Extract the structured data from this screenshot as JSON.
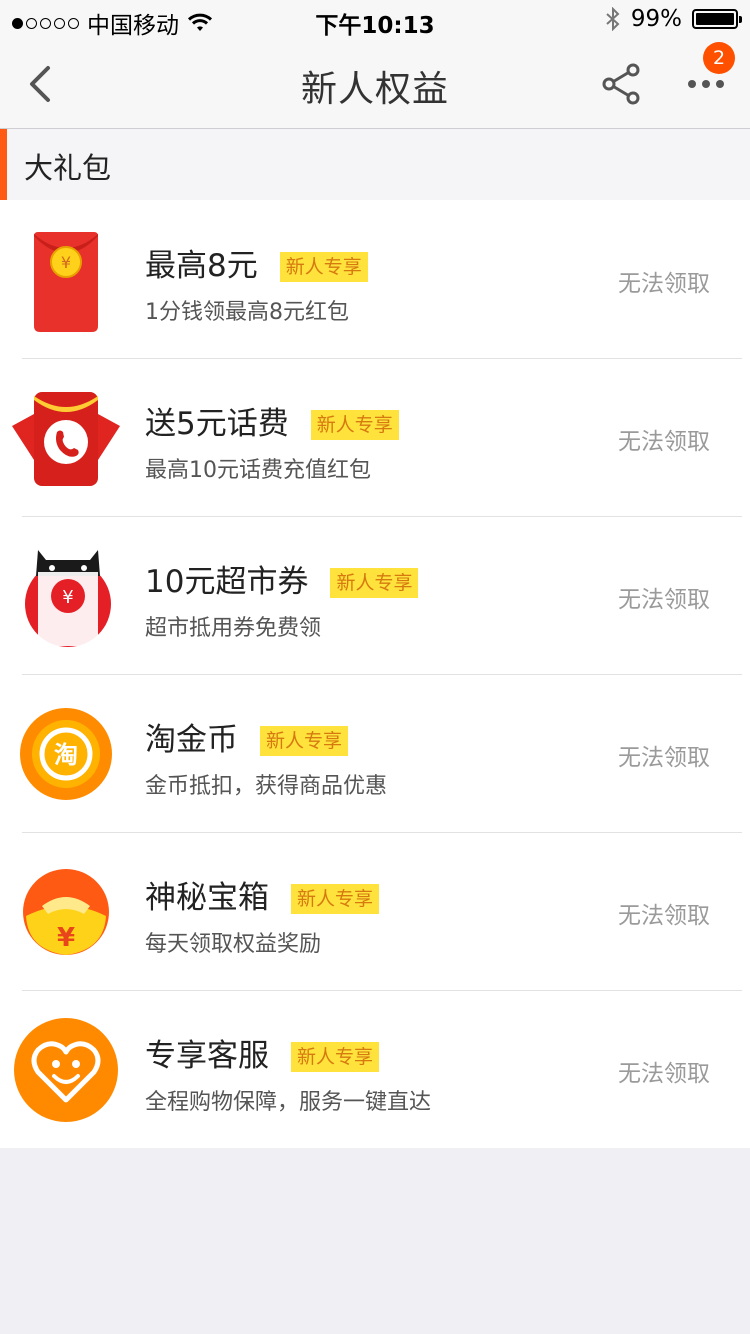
{
  "status_bar": {
    "carrier": "中国移动",
    "time": "下午10:13",
    "battery": "99%",
    "battery_level": 0.99
  },
  "nav": {
    "title": "新人权益",
    "badge_count": "2",
    "icons": [
      "back-arrow-icon",
      "share-icon",
      "more-icon"
    ]
  },
  "section": {
    "title": "大礼包",
    "accent_color": "#ff5a14"
  },
  "tag_colors": {
    "background": "#ffe23c",
    "text": "#d67a10"
  },
  "items": [
    {
      "title": "最高8元",
      "tag": "新人专享",
      "desc": "1分钱领最高8元红包",
      "action": "无法领取",
      "icon": "red-envelope-icon"
    },
    {
      "title": "送5元话费",
      "tag": "新人专享",
      "desc": "最高10元话费充值红包",
      "action": "无法领取",
      "icon": "phone-red-envelope-icon"
    },
    {
      "title": "10元超市券",
      "tag": "新人专享",
      "desc": "超市抵用券免费领",
      "action": "无法领取",
      "icon": "tmall-coupon-icon"
    },
    {
      "title": "淘金币",
      "tag": "新人专享",
      "desc": "金币抵扣，获得商品优惠",
      "action": "无法领取",
      "icon": "taojinbi-coin-icon"
    },
    {
      "title": "神秘宝箱",
      "tag": "新人专享",
      "desc": "每天领取权益奖励",
      "action": "无法领取",
      "icon": "treasure-box-icon"
    },
    {
      "title": "专享客服",
      "tag": "新人专享",
      "desc": "全程购物保障，服务一键直达",
      "action": "无法领取",
      "icon": "customer-service-heart-icon"
    }
  ],
  "icon_glyphs": {
    "yuan": "¥",
    "tao": "淘"
  }
}
